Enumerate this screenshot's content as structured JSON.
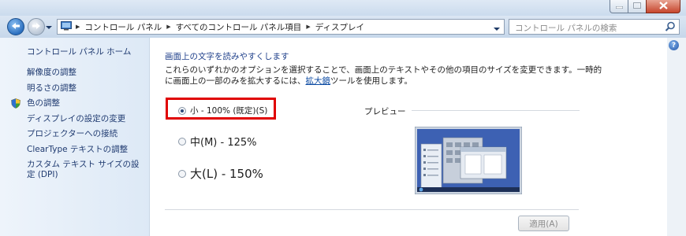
{
  "window": {
    "minimize_icon": "minimize-icon",
    "maximize_icon": "maximize-icon",
    "close_icon": "close-icon"
  },
  "nav": {
    "breadcrumbs": [
      "コントロール パネル",
      "すべてのコントロール パネル項目",
      "ディスプレイ"
    ],
    "search_placeholder": "コントロール パネルの検索"
  },
  "sidebar": {
    "home": "コントロール パネル ホーム",
    "links": [
      "解像度の調整",
      "明るさの調整",
      "色の調整",
      "ディスプレイの設定の変更",
      "プロジェクターへの接続",
      "ClearType テキストの調整",
      "カスタム テキスト サイズの設定 (DPI)"
    ]
  },
  "main": {
    "heading": "画面上の文字を読みやすくします",
    "description_pre": "これらのいずれかのオプションを選択することで、画面上のテキストやその他の項目のサイズを変更できます。一時的に画面上の一部のみを拡大するには、",
    "description_link": "拡大鏡",
    "description_post": "ツールを使用します。",
    "options": [
      {
        "label": "小 - 100% (既定)(S)",
        "selected": true
      },
      {
        "label": "中(M) - 125%",
        "selected": false
      },
      {
        "label": "大(L) - 150%",
        "selected": false
      }
    ],
    "preview_label": "プレビュー",
    "apply_button": "適用(A)"
  },
  "colors": {
    "highlight_box": "#e00000",
    "link": "#1f3a70",
    "heading": "#1e3f8a"
  }
}
